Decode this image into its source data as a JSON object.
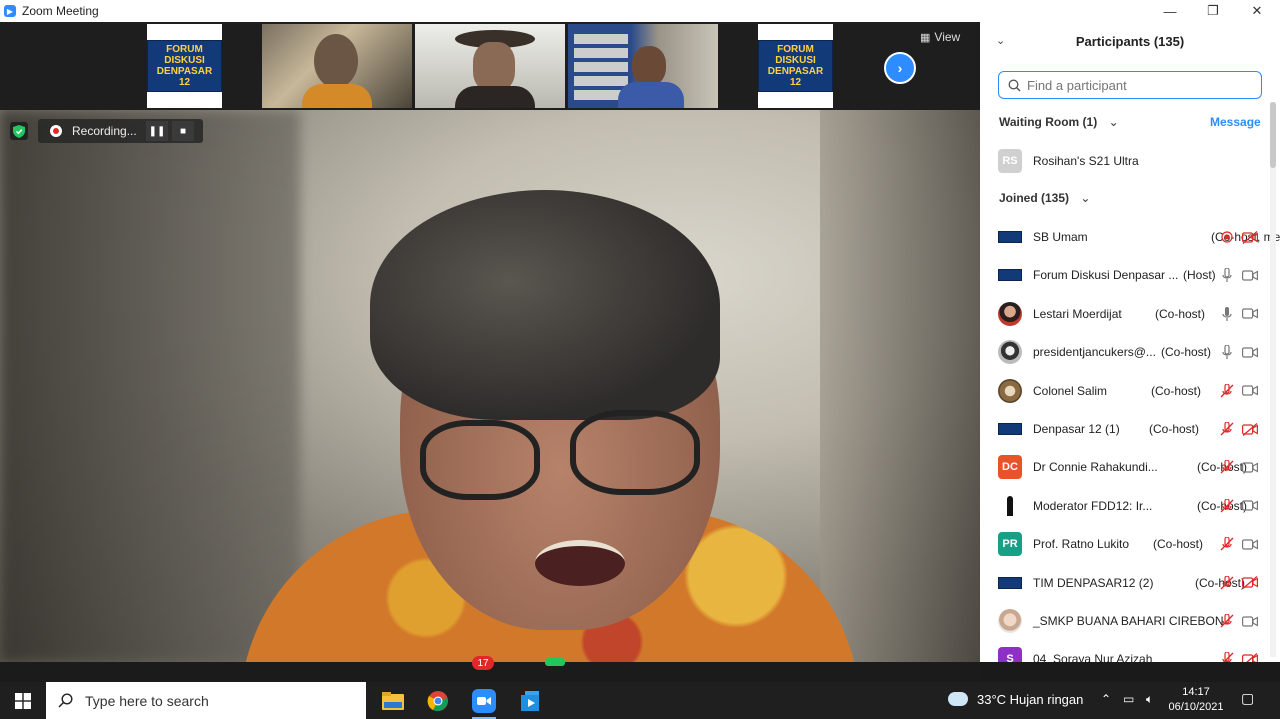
{
  "window": {
    "app_icon": "zoom-icon",
    "title": "Zoom Meeting"
  },
  "strip": {
    "forum_logo_lines": [
      "FORUM DISKUSI",
      "DENPASAR 12"
    ],
    "view_label": "View"
  },
  "recording": {
    "label": "Recording..."
  },
  "panel": {
    "title": "Participants (135)",
    "search_placeholder": "Find a participant",
    "waiting_room": {
      "title": "Waiting Room (1)",
      "message_label": "Message",
      "items": [
        {
          "initials": "RS",
          "name": "Rosihan's S21 Ultra"
        }
      ]
    },
    "joined_title": "Joined (135)",
    "participants": [
      {
        "name": "SB Umam",
        "role": "(Co-host, me)",
        "avatar": "forum-logo",
        "mic": "recording",
        "video": "off"
      },
      {
        "name": "Forum Diskusi Denpasar ...",
        "role": "(Host)",
        "avatar": "forum-logo",
        "mic": "on",
        "video": "on"
      },
      {
        "name": "Lestari Moerdijat",
        "role": "(Co-host)",
        "avatar": "photo-red",
        "mic": "active",
        "video": "on"
      },
      {
        "name": "presidentjancukers@...",
        "role": "(Co-host)",
        "avatar": "photo-bw",
        "mic": "on",
        "video": "on"
      },
      {
        "name": "Colonel Salim",
        "role": "(Co-host)",
        "avatar": "photo-circle",
        "mic": "off",
        "video": "on"
      },
      {
        "name": "Denpasar 12 (1)",
        "role": "(Co-host)",
        "avatar": "forum-logo",
        "mic": "off",
        "video": "off"
      },
      {
        "name": "Dr Connie Rahakundi...",
        "role": "(Co-host)",
        "avatar": "initials",
        "initials": "DC",
        "color": "#e8542a",
        "mic": "off",
        "video": "on"
      },
      {
        "name": "Moderator FDD12: Ir...",
        "role": "(Co-host)",
        "avatar": "photo-figure",
        "mic": "off",
        "video": "on"
      },
      {
        "name": "Prof. Ratno Lukito",
        "role": "(Co-host)",
        "avatar": "initials",
        "initials": "PR",
        "color": "#16a085",
        "mic": "off",
        "video": "on"
      },
      {
        "name": "TIM DENPASAR12 (2)",
        "role": "(Co-host)",
        "avatar": "forum-logo",
        "mic": "off",
        "video": "off"
      },
      {
        "name": "_SMKP BUANA BAHARI CIREBON",
        "role": "",
        "avatar": "photo-face",
        "mic": "off",
        "video": "on"
      },
      {
        "name": "04_Soraya Nur Azizah",
        "role": "",
        "avatar": "initials",
        "initials": "S",
        "color": "#8e2fc7",
        "mic": "off",
        "video": "off"
      }
    ]
  },
  "taskbar": {
    "search_placeholder": "Type here to search",
    "zoom_badge": "17",
    "weather": "33°C  Hujan ringan",
    "time": "14:17",
    "date": "06/10/2021"
  }
}
